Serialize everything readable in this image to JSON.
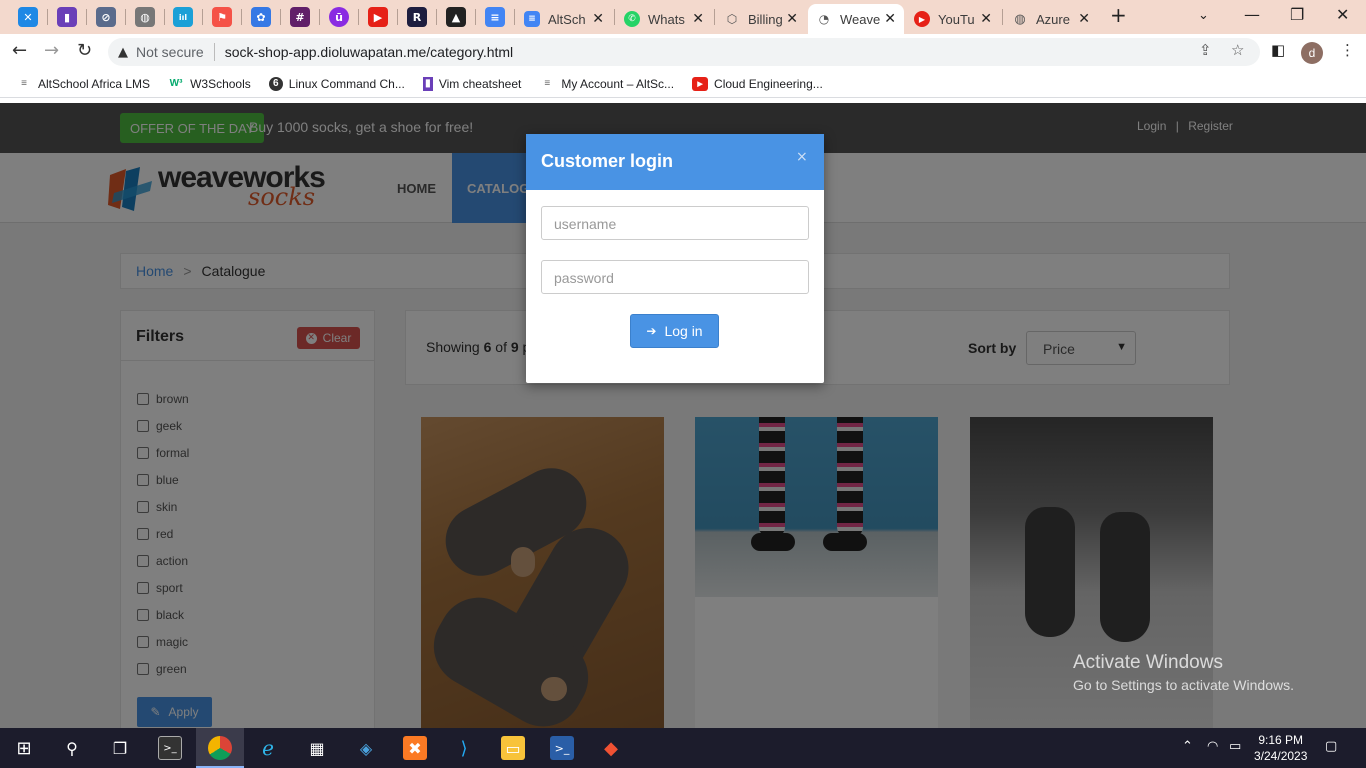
{
  "browser": {
    "tabs": [
      {
        "label": "AltSch",
        "favicon": "docs-icon"
      },
      {
        "label": "Whats",
        "favicon": "whatsapp-icon"
      },
      {
        "label": "Billing",
        "favicon": "cube-icon"
      },
      {
        "label": "Weave",
        "favicon": "page-icon"
      },
      {
        "label": "YouTu",
        "favicon": "youtube-icon"
      },
      {
        "label": "Azure",
        "favicon": "globe-icon"
      }
    ],
    "address": {
      "security_label": "Not secure",
      "url": "sock-shop-app.dioluwapatan.me/category.html"
    },
    "profile_initial": "d",
    "bookmarks": [
      "AltSchool Africa LMS",
      "W3Schools",
      "Linux Command Ch...",
      "Vim cheatsheet",
      "My Account – AltSc...",
      "Cloud Engineering..."
    ]
  },
  "site": {
    "offer_badge": "OFFER OF THE DAY",
    "offer_text": "Buy 1000 socks, get a shoe for free!",
    "login_link": "Login",
    "link_separator": "|",
    "register_link": "Register",
    "logo_main": "weaveworks",
    "logo_sub": "socks",
    "menu": {
      "home": "HOME",
      "catalogue": "CATALOGUE"
    },
    "breadcrumb": {
      "home": "Home",
      "separator": ">",
      "current": "Catalogue"
    },
    "filters": {
      "title": "Filters",
      "clear_label": "Clear",
      "apply_label": "Apply",
      "items": [
        "brown",
        "geek",
        "formal",
        "blue",
        "skin",
        "red",
        "action",
        "sport",
        "black",
        "magic",
        "green"
      ]
    },
    "listing": {
      "showing_prefix": "Showing",
      "shown": "6",
      "of_word": "of",
      "total": "9",
      "trailing_visible": "p",
      "sort_label": "Sort by",
      "sort_value": "Price"
    }
  },
  "modal": {
    "title": "Customer login",
    "close_glyph": "×",
    "username_placeholder": "username",
    "password_placeholder": "password",
    "login_button": "Log in"
  },
  "watermark": {
    "line1": "Activate Windows",
    "line2": "Go to Settings to activate Windows."
  },
  "taskbar": {
    "time": "9:16 PM",
    "date": "3/24/2023"
  },
  "colors": {
    "accent_blue": "#4993e4",
    "offer_green": "#4fbf40",
    "clear_red": "#d9534f",
    "tabbar_bg": "#f3d9cd"
  }
}
